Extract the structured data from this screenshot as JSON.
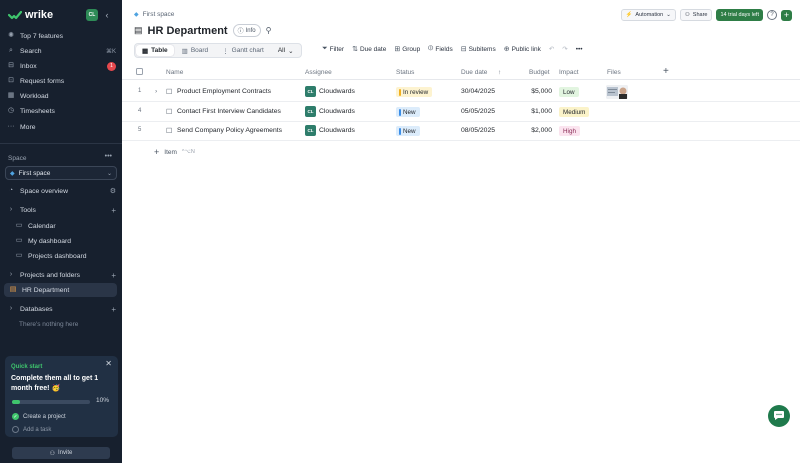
{
  "brand": {
    "name": "wrike",
    "workspace_initials": "CL",
    "color": "#3fc56d"
  },
  "sidebar": {
    "nav": [
      {
        "icon": "sparkle-icon",
        "label": "Top 7 features",
        "right": ""
      },
      {
        "icon": "search-icon",
        "label": "Search",
        "right": "⌘K"
      },
      {
        "icon": "inbox-icon",
        "label": "Inbox",
        "right": "1"
      },
      {
        "icon": "form-icon",
        "label": "Request forms",
        "right": ""
      },
      {
        "icon": "workload-icon",
        "label": "Workload",
        "right": ""
      },
      {
        "icon": "clock-icon",
        "label": "Timesheets",
        "right": ""
      },
      {
        "icon": "more-icon",
        "label": "More",
        "right": ""
      }
    ],
    "space_label": "Space",
    "space_dots": "•••",
    "space_selected": "First space",
    "space_overview": "Space overview",
    "tools_label": "Tools",
    "tools": [
      "Calendar",
      "My dashboard",
      "Projects dashboard"
    ],
    "projects_label": "Projects and folders",
    "project_active": "HR Department",
    "databases_label": "Databases",
    "databases_empty": "There's nothing here",
    "quick_start": {
      "label": "Quick start",
      "heading": "Complete them all to get 1 month free! 🥳",
      "progress": 10,
      "progress_text": "10%",
      "tasks": [
        {
          "label": "Create a project",
          "done": true
        },
        {
          "label": "Add a task",
          "done": false
        }
      ]
    },
    "invite_label": "Invite"
  },
  "header": {
    "breadcrumb": "First space",
    "title": "HR Department",
    "info_label": "Info",
    "automation_label": "Automation",
    "share_label": "Share",
    "trial_label": "14 trial days left"
  },
  "views": {
    "tabs": [
      {
        "label": "Table",
        "active": true
      },
      {
        "label": "Board",
        "active": false
      },
      {
        "label": "Gantt chart",
        "active": false
      }
    ],
    "all_label": "All"
  },
  "toolbar": {
    "filter": "Filter",
    "due_date": "Due date",
    "group": "Group",
    "fields": "Fields",
    "subitems": "Subitems",
    "public_link": "Public link",
    "more": "•••"
  },
  "table": {
    "columns": {
      "name": "Name",
      "assignee": "Assignee",
      "status": "Status",
      "due": "Due date",
      "budget": "Budget",
      "impact": "Impact",
      "files": "Files",
      "add": "+"
    },
    "rows": [
      {
        "num": "1",
        "name": "Product Employment Contracts",
        "assignee": "Cloudwards",
        "status": "In review",
        "due": "30/04/2025",
        "budget": "$5,000",
        "impact": "Low",
        "has_expand": true,
        "has_file": true
      },
      {
        "num": "4",
        "name": "Contact First Interview Candidates",
        "assignee": "Cloudwards",
        "status": "New",
        "due": "05/05/2025",
        "budget": "$1,000",
        "impact": "Medium",
        "has_expand": false,
        "has_file": false
      },
      {
        "num": "5",
        "name": "Send Company Policy Agreements",
        "assignee": "Cloudwards",
        "status": "New",
        "due": "08/05/2025",
        "budget": "$2,000",
        "impact": "High",
        "has_expand": false,
        "has_file": false
      }
    ],
    "add_item_label": "Item",
    "add_item_shortcut": "^⌥N"
  },
  "colors": {
    "status_in_review": {
      "bg": "#fdf3d0",
      "bar": "#f2b01e"
    },
    "status_new": {
      "bg": "#dcecfb",
      "bar": "#3b8ee8"
    },
    "impact_low": "#e2f5e0",
    "impact_medium": "#fbf3c9",
    "impact_high": "#fbe4ef"
  }
}
